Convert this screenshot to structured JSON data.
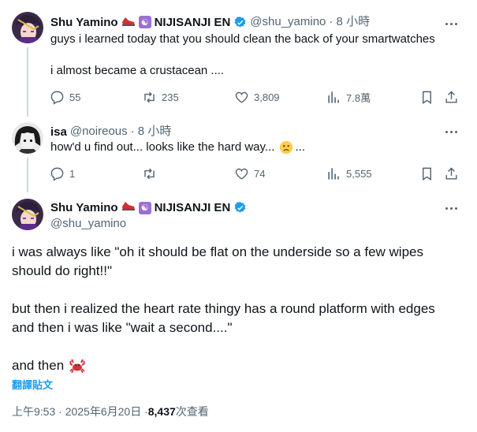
{
  "colors": {
    "text": "#0f1419",
    "muted": "#536471",
    "link": "#1d9bf0",
    "verified": "#1d9bf0",
    "line": "#cfd9de"
  },
  "tweet1": {
    "name": "Shu Yamino",
    "org": "NIJISANJI EN",
    "handle": "@shu_yamino",
    "time": "· 8 小時",
    "line1": "guys i learned today that you should clean the back of your smartwatches",
    "line2": "i almost became a crustacean ....",
    "replies": "55",
    "retweets": "235",
    "likes": "3,809",
    "views": "7.8萬"
  },
  "tweet2": {
    "name": "isa",
    "handle": "@noireous",
    "time": "· 8 小時",
    "text": "how'd u find out... looks like the hard way...",
    "text_end": "...",
    "replies": "1",
    "retweets": "",
    "likes": "74",
    "views": "5,555"
  },
  "tweet3": {
    "name": "Shu Yamino",
    "org": "NIJISANJI EN",
    "handle": "@shu_yamino",
    "p1a": "i was always like \"oh it should be flat on the underside so a few wipes",
    "p1b": "should do right!!\"",
    "p2a": "but then i realized the heart rate thingy has a round platform with edges",
    "p2b": "and then i was like \"wait a second....\"",
    "p3": "and then",
    "translate": "翻譯貼文",
    "timestamp": "上午9:53 · 2025年6月20日 · ",
    "views_count": "8,437",
    "views_label": " 次查看"
  }
}
